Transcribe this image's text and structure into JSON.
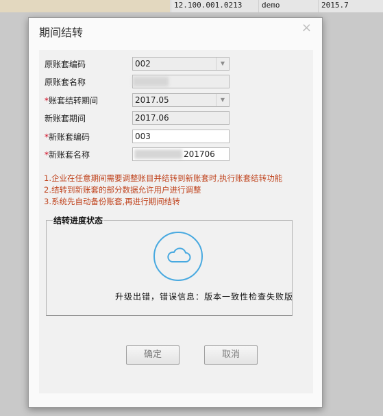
{
  "background_row": {
    "ip": "12.100.001.0213",
    "user": "demo",
    "year": "2015.7"
  },
  "dialog": {
    "title": "期间结转",
    "close_glyph": "×",
    "fields": {
      "orig_code": {
        "label": "原账套编码",
        "value": "002"
      },
      "orig_name": {
        "label": "原账套名称",
        "value": ""
      },
      "transfer_period": {
        "required_mark": "*",
        "label": "账套结转期间",
        "value": "2017.05"
      },
      "new_period": {
        "label": "新账套期间",
        "value": "2017.06"
      },
      "new_code": {
        "required_mark": "*",
        "label": "新账套编码",
        "value": "003"
      },
      "new_name": {
        "required_mark": "*",
        "label": "新账套名称",
        "value": "201706"
      }
    },
    "notes": [
      "1.企业在任意期间需要调整账目并结转到新账套时,执行账套结转功能",
      "2.结转到新账套的部分数据允许用户进行调整",
      "3.系统先自动备份账套,再进行期间结转"
    ],
    "progress": {
      "legend": "结转进度状态",
      "icon": "cloud-icon",
      "message": "升级出错，错误信息：版本一致性检查失败版本一致"
    },
    "buttons": {
      "ok": "确定",
      "cancel": "取消"
    }
  },
  "colors": {
    "accent": "#48a9e0",
    "note_text": "#c0441e",
    "required": "#d0021b"
  }
}
